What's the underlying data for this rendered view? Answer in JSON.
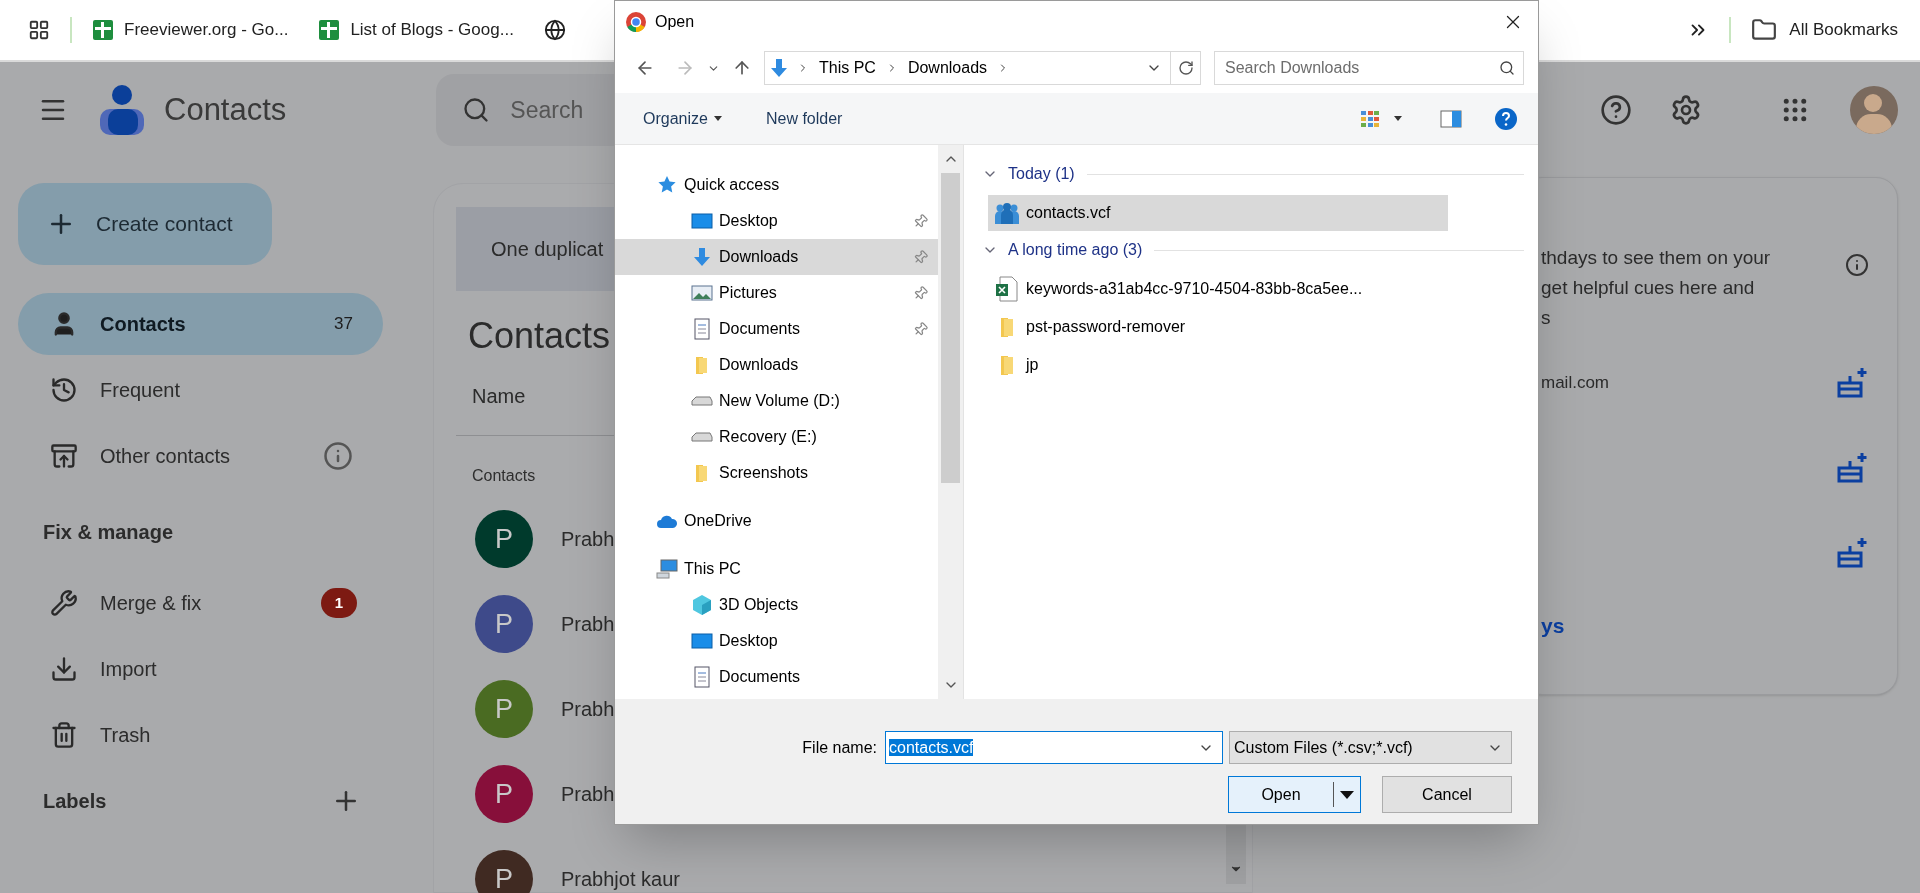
{
  "bookmarks_bar": {
    "items": [
      {
        "kind": "sheets",
        "label": "Freeviewer.org - Go..."
      },
      {
        "kind": "sheets",
        "label": "List of Blogs - Goog..."
      },
      {
        "kind": "globe"
      }
    ],
    "all_bookmarks": "All Bookmarks"
  },
  "app_header": {
    "title": "Contacts",
    "search_placeholder": "Search"
  },
  "create_button": "Create contact",
  "nav": [
    {
      "kind": "contacts",
      "label": "Contacts",
      "count": "37",
      "selected": true
    },
    {
      "kind": "frequent",
      "label": "Frequent",
      "selected": false
    },
    {
      "kind": "other",
      "label": "Other contacts",
      "selected": false
    }
  ],
  "fix_manage": {
    "heading": "Fix & manage",
    "items": [
      {
        "kind": "merge",
        "label": "Merge & fix",
        "badge": "1"
      },
      {
        "kind": "import",
        "label": "Import"
      },
      {
        "kind": "trash",
        "label": "Trash"
      }
    ]
  },
  "labels": {
    "heading": "Labels"
  },
  "main": {
    "banner": "One duplicat",
    "heading": "Contacts",
    "column_1": "Name",
    "section": "Contacts",
    "rows": [
      {
        "initial": "P",
        "name": "Prabh",
        "color": "#003a2c"
      },
      {
        "initial": "P",
        "name": "Prabh",
        "color": "#3e4a8a"
      },
      {
        "initial": "P",
        "name": "Prabh",
        "color": "#4a6b22"
      },
      {
        "initial": "P",
        "name": "Prabh",
        "color": "#870f3a"
      },
      {
        "initial": "P",
        "name": "Prabhjot kaur",
        "color": "#402a22"
      }
    ]
  },
  "birthdays_card": {
    "lines": [
      "thdays to see them on your",
      "get helpful cues here and",
      "s"
    ],
    "rows": [
      {
        "kind": "contact",
        "detail": "mail.com"
      },
      {
        "kind": "contact"
      },
      {
        "kind": "contact"
      }
    ],
    "link": "ys"
  },
  "dialog": {
    "title": "Open",
    "path": [
      "This PC",
      "Downloads"
    ],
    "search_placeholder": "Search Downloads",
    "organize": "Organize",
    "new_folder": "New folder",
    "tree": [
      {
        "kind": "star",
        "label": "Quick access",
        "selected": false,
        "pinned": false,
        "children": [
          {
            "kind": "desktop",
            "label": "Desktop",
            "selected": false,
            "pinned": true
          },
          {
            "kind": "download",
            "label": "Downloads",
            "selected": true,
            "pinned": true
          },
          {
            "kind": "pictures",
            "label": "Pictures",
            "selected": false,
            "pinned": true
          },
          {
            "kind": "documents",
            "label": "Documents",
            "selected": false,
            "pinned": true
          },
          {
            "kind": "folder",
            "label": "Downloads",
            "selected": false,
            "pinned": false
          },
          {
            "kind": "drive",
            "label": "New Volume (D:)",
            "selected": false,
            "pinned": false
          },
          {
            "kind": "drive",
            "label": "Recovery (E:)",
            "selected": false,
            "pinned": false
          },
          {
            "kind": "folder",
            "label": "Screenshots",
            "selected": false,
            "pinned": false
          }
        ]
      },
      {
        "kind": "cloud",
        "label": "OneDrive",
        "selected": false,
        "pinned": false
      },
      {
        "kind": "pc",
        "label": "This PC",
        "selected": false,
        "pinned": false,
        "children": [
          {
            "kind": "cube",
            "label": "3D Objects",
            "selected": false,
            "pinned": false
          },
          {
            "kind": "desktop",
            "label": "Desktop",
            "selected": false,
            "pinned": false
          },
          {
            "kind": "documents",
            "label": "Documents",
            "selected": false,
            "pinned": false
          }
        ]
      }
    ],
    "groups": [
      {
        "label": "Today (1)",
        "files": [
          {
            "kind": "contacts",
            "name": "contacts.vcf",
            "selected": true
          }
        ]
      },
      {
        "label": "A long time ago (3)",
        "files": [
          {
            "kind": "excel",
            "name": "keywords-a31ab4cc-9710-4504-83bb-8ca5ee...",
            "selected": false
          },
          {
            "kind": "folder",
            "name": "pst-password-remover",
            "selected": false
          },
          {
            "kind": "folder",
            "name": "jp",
            "selected": false
          }
        ]
      }
    ],
    "file_name_label": "File name:",
    "file_name": "contacts.vcf",
    "file_name_selected": true,
    "file_type": "Custom Files (*.csv;*.vcf)",
    "buttons": [
      {
        "kind": "split",
        "label": "Open"
      },
      {
        "kind": "plain",
        "label": "Cancel"
      }
    ]
  }
}
